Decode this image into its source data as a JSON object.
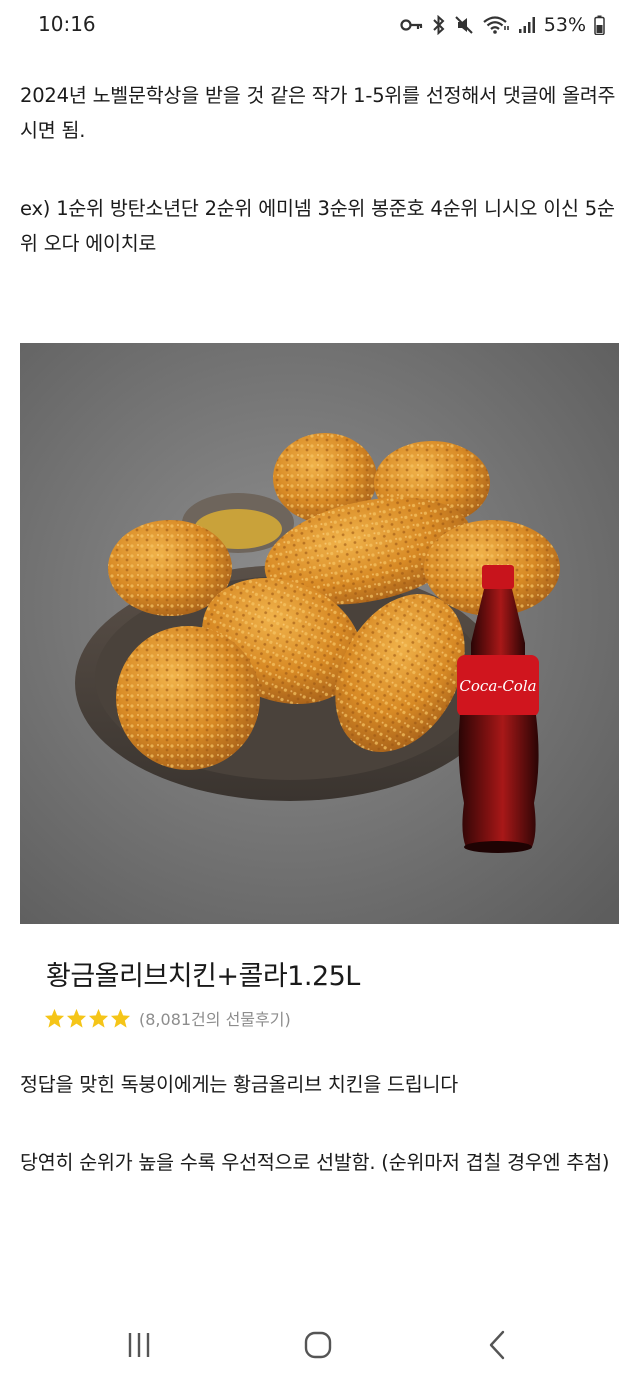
{
  "status_bar": {
    "time": "10:16",
    "battery": "53%",
    "icons": [
      "key-icon",
      "bluetooth-icon",
      "mute-icon",
      "wifi-icon",
      "signal-icon",
      "battery-icon"
    ]
  },
  "post": {
    "paragraph1": "2024년 노벨문학상을 받을 것 같은 작가 1-5위를 선정해서 댓글에 올려주시면 됨.",
    "paragraph2": "ex) 1순위 방탄소년단 2순위 에미넴 3순위 봉준호 4순위 니시오 이신 5순위 오다 에이치로",
    "paragraph3": "정답을 맞힌 독붕이에게는 황금올리브 치킨을 드립니다",
    "paragraph4": "당연히 순위가 높을 수록 우선적으로 선발함. (순위마저 겹칠 경우엔 추첨)"
  },
  "product": {
    "name": "황금올리브치킨+콜라1.25L",
    "rating_stars": 4,
    "review_count": "(8,081건의 선물후기)",
    "bottle_label": "Coca-Cola",
    "star_color": "#f5c518"
  },
  "nav_bar": {
    "buttons": [
      "recent-apps-icon",
      "home-icon",
      "back-icon"
    ]
  }
}
